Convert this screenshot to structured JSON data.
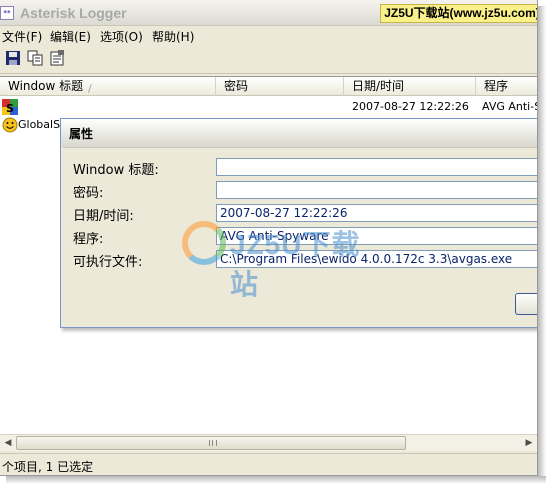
{
  "window": {
    "title": "Asterisk Logger",
    "icon": "app-icon",
    "icon_text": "**"
  },
  "watermark": {
    "badge_text": "JZ5U下载站(www.jz5u.com)",
    "logo_text": "JZ5U下载站"
  },
  "menu": [
    "文件(F)",
    "编辑(E)",
    "选项(O)",
    "帮助(H)"
  ],
  "toolbar": [
    {
      "icon": "save-icon"
    },
    {
      "icon": "copy-icon"
    },
    {
      "icon": "properties-icon"
    }
  ],
  "list": {
    "columns": [
      "Window 标题",
      "密码",
      "日期/时间",
      "程序"
    ],
    "rows": [
      {
        "icon": "avg-icon",
        "title": "",
        "password": "",
        "datetime": "2007-08-27 12:22:26",
        "program": "AVG Anti-Sp"
      },
      {
        "icon": "smiley-icon",
        "title": "GlobalSC",
        "password": "",
        "datetime": "",
        "program": ""
      }
    ]
  },
  "status": {
    "text": "个项目, 1 已选定"
  },
  "dialog": {
    "title": "属性",
    "fields": [
      {
        "label": "Window 标题:",
        "value": ""
      },
      {
        "label": "密码:",
        "value": ""
      },
      {
        "label": "日期/时间:",
        "value": "2007-08-27 12:22:26"
      },
      {
        "label": "程序:",
        "value": "AVG Anti-Spyware"
      },
      {
        "label": "可执行文件:",
        "value": "C:\\Program Files\\ewido 4.0.0.172c 3.3\\avgas.exe"
      }
    ]
  },
  "colors": {
    "titlebar_text": "#a8a8a8",
    "badge_bg": "#fbf18a",
    "input_text": "#0a246a",
    "input_border": "#7f9db9"
  }
}
